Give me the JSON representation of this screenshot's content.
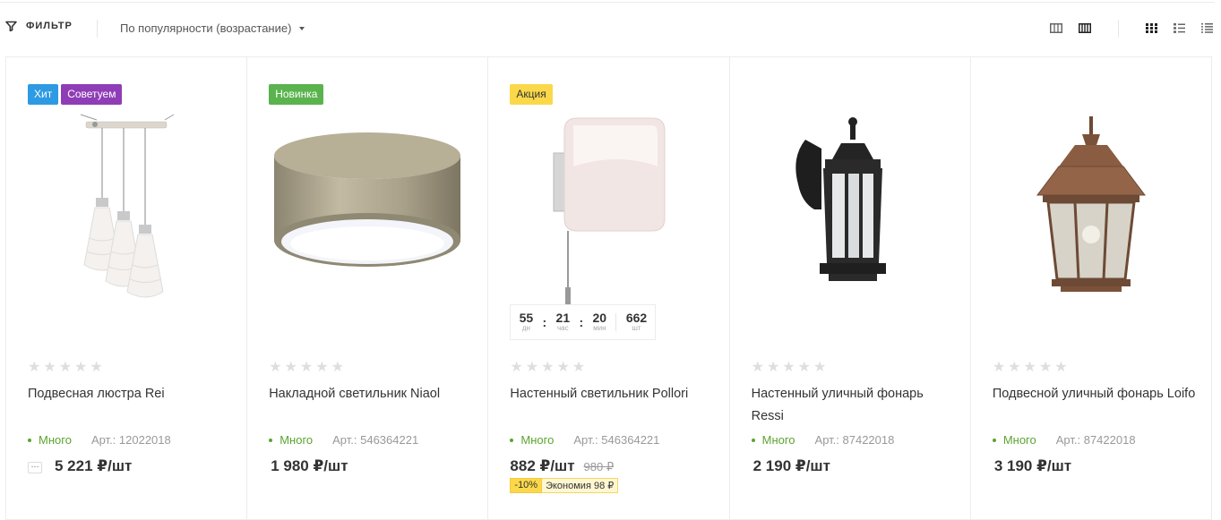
{
  "toolbar": {
    "filter_label": "ФИЛЬТР",
    "sort_label": "По популярности (возрастание)"
  },
  "colors": {
    "hit": "#2d9ae3",
    "recommend": "#8f3db6",
    "new": "#5ab34d",
    "sale": "#fbd84a",
    "in_stock": "#5ca42f"
  },
  "products": [
    {
      "badges": [
        "Хит",
        "Советуем"
      ],
      "name": "Подвесная люстра Rei",
      "stock": "Много",
      "article": "Арт.: 12022018",
      "more": "···",
      "price": "5 221 ₽/шт"
    },
    {
      "badges": [
        "Новинка"
      ],
      "name": "Накладной светильник Niaol",
      "stock": "Много",
      "article": "Арт.: 546364221",
      "price": "1 980 ₽/шт"
    },
    {
      "badges": [
        "Акция"
      ],
      "name": "Настенный светильник Pollori",
      "stock": "Много",
      "article": "Арт.: 546364221",
      "price": "882 ₽/шт",
      "old_price": "980 ₽",
      "discount_percent": "-10%",
      "discount_save": "Экономия 98 ₽",
      "timer": {
        "days": "55",
        "days_label": "дн",
        "hours": "21",
        "hours_label": "час",
        "minutes": "20",
        "minutes_label": "мин",
        "qty": "662",
        "qty_label": "шт"
      }
    },
    {
      "badges": [],
      "name": "Настенный уличный фонарь Ressi",
      "stock": "Много",
      "article": "Арт.: 87422018",
      "price": "2 190 ₽/шт"
    },
    {
      "badges": [],
      "name": "Подвесной уличный фонарь Loifo",
      "stock": "Много",
      "article": "Арт.: 87422018",
      "price": "3 190 ₽/шт"
    }
  ]
}
